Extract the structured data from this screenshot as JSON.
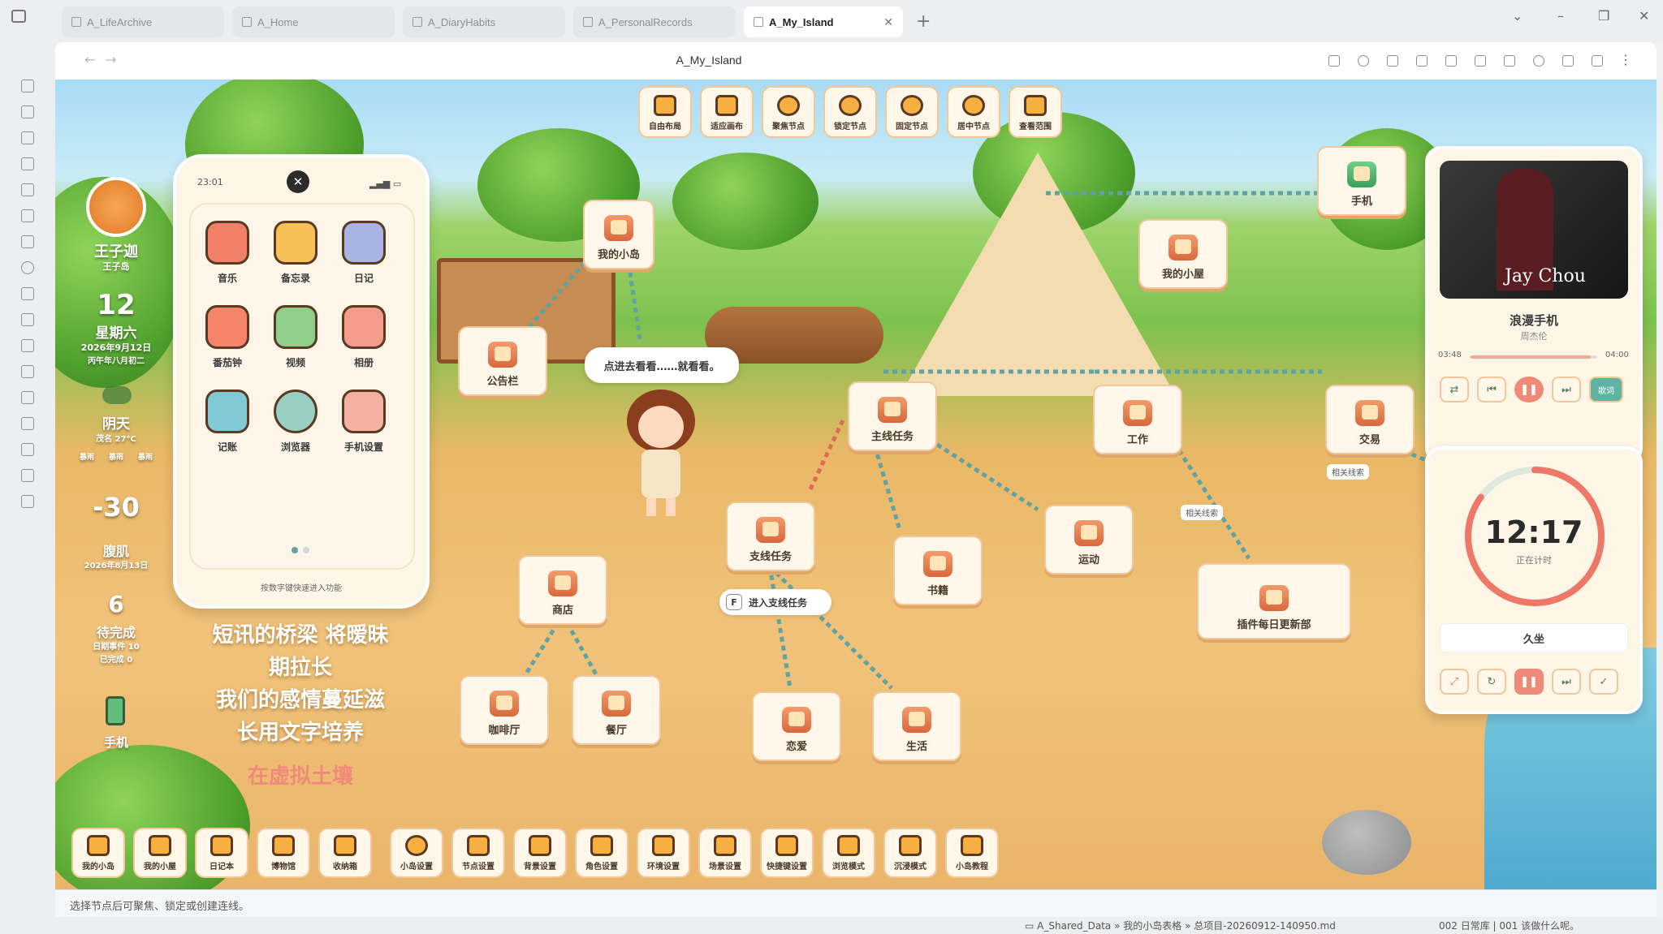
{
  "tabs": [
    {
      "label": "A_LifeArchive"
    },
    {
      "label": "A_Home"
    },
    {
      "label": "A_DiaryHabits"
    },
    {
      "label": "A_PersonalRecords"
    },
    {
      "label": "A_My_Island"
    }
  ],
  "page_title": "A_My_Island",
  "top_toolbar": [
    "自由布局",
    "适应画布",
    "聚焦节点",
    "锁定节点",
    "固定节点",
    "居中节点",
    "查看范围"
  ],
  "profile": {
    "name": "王子迦",
    "sub": "王子岛",
    "day": "12",
    "weekday": "星期六",
    "date": "2026年9月12日",
    "lunar": "丙午年八月初二",
    "weather": "阴天",
    "weather_detail": "茂名 27°C",
    "countdown": "-30",
    "countdown_label": "腹肌",
    "countdown_date": "2026年8月13日",
    "todo_count": "6",
    "todo_label": "待完成",
    "todo_event": "日期事件 10",
    "todo_done": "已完成 0",
    "phone_label": "手机",
    "forecast": [
      "暴雨",
      "暴雨",
      "暴雨"
    ]
  },
  "phone": {
    "time": "23:01",
    "hint": "按数字键快速进入功能",
    "apps": [
      "音乐",
      "备忘录",
      "日记",
      "番茄钟",
      "视频",
      "相册",
      "记账",
      "浏览器",
      "手机设置"
    ]
  },
  "lyrics": [
    "短讯的桥梁 将暧昧",
    "期拉长",
    "我们的感情蔓延滋",
    "长用文字培养",
    "在虚拟土壤"
  ],
  "nodes": {
    "my_island": "我的小岛",
    "bulletin": "公告栏",
    "my_house": "我的小屋",
    "main_quest": "主线任务",
    "side_quest": "支线任务",
    "shop": "商店",
    "cafe": "咖啡厅",
    "restaurant": "餐厅",
    "books": "书籍",
    "sport": "运动",
    "work": "工作",
    "trade": "交易",
    "plugin": "插件每日更新部",
    "love": "恋爱",
    "life": "生活",
    "phone": "手机"
  },
  "bubble": "点进去看看……就看看。",
  "enter_side": {
    "key": "F",
    "label": "进入支线任务"
  },
  "link_tags": [
    "相关线索",
    "相关线索"
  ],
  "music": {
    "title": "浪漫手机",
    "artist": "周杰伦",
    "cur": "03:48",
    "total": "04:00",
    "progress": 0.95,
    "lyric_btn": "歌词",
    "album_text": "Jay Chou"
  },
  "timer": {
    "time": "12:17",
    "status": "正在计时",
    "task": "久坐",
    "progress": 0.85
  },
  "bottom_toolbar": [
    "我的小岛",
    "我的小屋",
    "日记本",
    "博物馆",
    "收纳箱",
    "小岛设置",
    "节点设置",
    "背景设置",
    "角色设置",
    "环境设置",
    "场景设置",
    "快捷键设置",
    "浏览模式",
    "沉浸模式",
    "小岛教程"
  ],
  "status_hint": "选择节点后可聚焦、锁定或创建连线。",
  "breadcrumb": {
    "a": "A_Shared_Data",
    "b": "我的小岛表格",
    "c": "总项目-20260912-140950.md"
  },
  "status_right": "002 日常库 | 001 该做什么呢。"
}
